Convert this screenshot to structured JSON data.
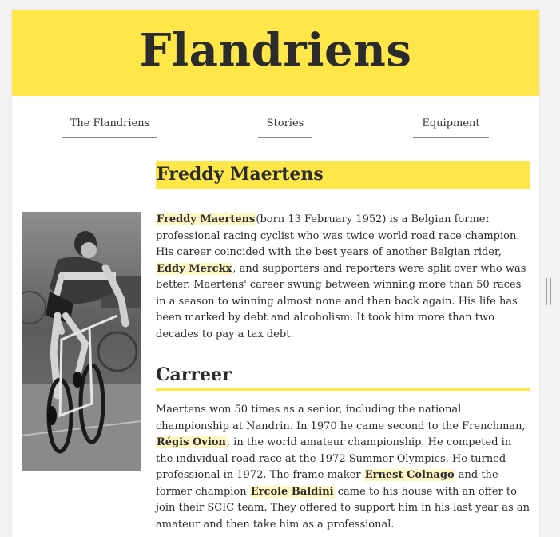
{
  "site": {
    "title": "Flandriens"
  },
  "nav": {
    "items": [
      {
        "label": "The Flandriens"
      },
      {
        "label": "Stories"
      },
      {
        "label": "Equipment"
      }
    ]
  },
  "article": {
    "title": "Freddy Maertens",
    "image_alt": "Black and white photo of a cyclist racing",
    "intro": {
      "name": "Freddy Maertens",
      "t1": "(born 13 February 1952) is a Belgian former professional racing cyclist who was twice world road race champion. His career coincided with the best years of another Belgian rider, ",
      "h1": "Eddy Merckx",
      "t2": ", and supporters and reporters were split over who was better. Maertens' career swung between winning more than 50 races in a season to winning almost none and then back again. His life has been marked by debt and alcoholism. It took him more than two decades to pay a tax debt."
    },
    "career": {
      "heading": "Carreer",
      "t1": "Maertens won 50 times as a senior, including the national championship at Nandrin. In 1970 he came second to the Frenchman, ",
      "h1": "Régis Ovion",
      "t2": ", in the world amateur championship. He competed in the individual road race at the 1972 Summer Olympics. He turned professional in 1972. The frame-maker ",
      "h2": "Ernest Colnago",
      "t3": " and the former champion ",
      "h3": "Ercole Baldini",
      "t4": " came to his house with an offer to join their SCIC team. They offered to support him in his last year as an amateur and then take him as a professional."
    }
  },
  "colors": {
    "accent": "#ffe74a",
    "highlight": "#fff6c4",
    "text": "#2b2b2b"
  }
}
